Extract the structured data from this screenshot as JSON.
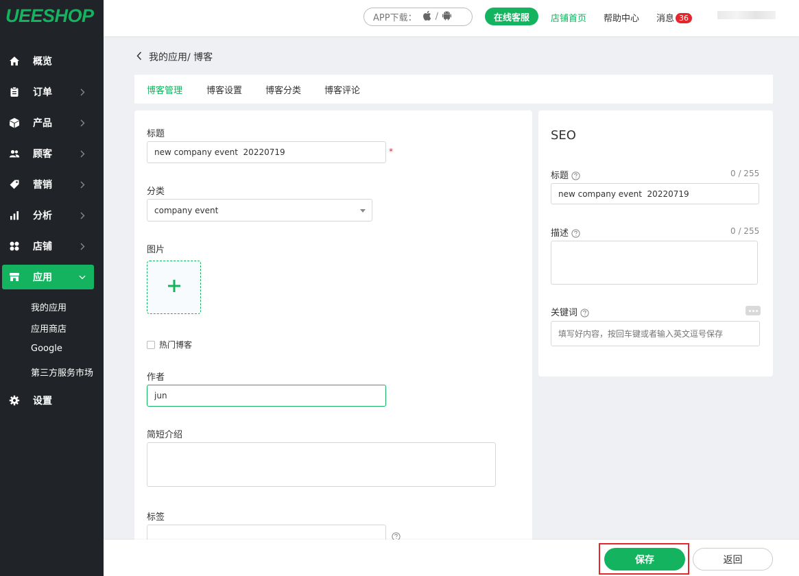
{
  "brand": {
    "logo": "UEESHOP",
    "accent": "#13b35f",
    "sidebar_bg": "#202428",
    "danger": "#e5252c"
  },
  "sidebar": {
    "items": [
      {
        "label": "概览",
        "icon": "home-icon"
      },
      {
        "label": "订单",
        "icon": "clipboard-icon"
      },
      {
        "label": "产品",
        "icon": "box-icon"
      },
      {
        "label": "顾客",
        "icon": "users-icon"
      },
      {
        "label": "营销",
        "icon": "tag-icon"
      },
      {
        "label": "分析",
        "icon": "bar-chart-icon"
      },
      {
        "label": "店铺",
        "icon": "grid-icon"
      },
      {
        "label": "应用",
        "icon": "store-icon",
        "active": true
      },
      {
        "label": "设置",
        "icon": "gear-icon"
      }
    ],
    "subitems": [
      "我的应用",
      "应用商店",
      "Google",
      "第三方服务市场"
    ]
  },
  "topbar": {
    "app_download": "APP下载：",
    "online_service": "在线客服",
    "store_home": "店铺首页",
    "help_center": "帮助中心",
    "messages": "消息",
    "message_count": "36"
  },
  "breadcrumb": {
    "text": "我的应用/ 博客"
  },
  "tabs": [
    "博客管理",
    "博客设置",
    "博客分类",
    "博客评论"
  ],
  "form": {
    "title_label": "标题",
    "title_value": "new company event  20220719",
    "required_mark": "*",
    "category_label": "分类",
    "category_value": "company event",
    "image_label": "图片",
    "hot_blog_label": "热门博客",
    "author_label": "作者",
    "author_value": "jun",
    "summary_label": "简短介绍",
    "tags_label": "标签"
  },
  "seo": {
    "heading": "SEO",
    "title_label": "标题",
    "title_counter": "0 / 255",
    "title_value": "new company event  20220719",
    "desc_label": "描述",
    "desc_counter": "0 / 255",
    "keywords_label": "关键词",
    "keywords_placeholder": "填写好内容，按回车键或者输入英文逗号保存"
  },
  "footer": {
    "save": "保存",
    "back": "返回"
  }
}
